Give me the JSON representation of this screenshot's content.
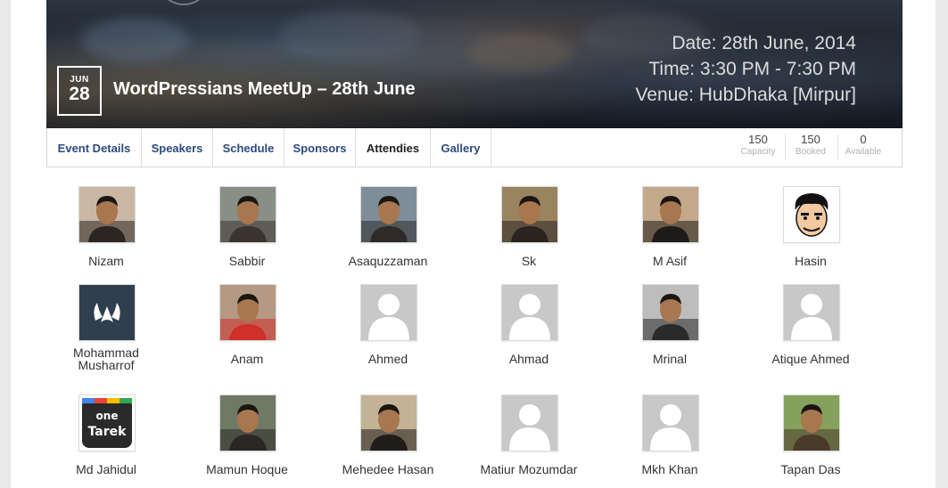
{
  "event": {
    "month": "JUN",
    "day": "28",
    "title": "WordPressians MeetUp – 28th June",
    "date_line": "Date: 28th June, 2014",
    "time_line": "Time: 3:30 PM - 7:30 PM",
    "venue_line": "Venue: HubDhaka [Mirpur]"
  },
  "tabs": [
    {
      "label": "Event Details"
    },
    {
      "label": "Speakers"
    },
    {
      "label": "Schedule"
    },
    {
      "label": "Sponsors"
    },
    {
      "label": "Attendies",
      "active": true
    },
    {
      "label": "Gallery"
    }
  ],
  "stats": [
    {
      "value": "150",
      "label": "Capacity"
    },
    {
      "value": "150",
      "label": "Booked"
    },
    {
      "value": "0",
      "label": "Available"
    }
  ],
  "attendees": [
    {
      "name": "Nizam",
      "avatar": "photo-icon"
    },
    {
      "name": "Sabbir",
      "avatar": "photo-icon"
    },
    {
      "name": "Asaquzzaman",
      "avatar": "photo-icon"
    },
    {
      "name": "Sk",
      "avatar": "photo-icon"
    },
    {
      "name": "M Asif",
      "avatar": "photo-icon"
    },
    {
      "name": "Hasin",
      "avatar": "cartoon-face-icon"
    },
    {
      "name": "Mohammad Musharrof",
      "avatar": "logo-icon"
    },
    {
      "name": "Anam",
      "avatar": "photo-icon"
    },
    {
      "name": "Ahmed",
      "avatar": "default-user-icon"
    },
    {
      "name": "Ahmad",
      "avatar": "default-user-icon"
    },
    {
      "name": "Mrinal",
      "avatar": "photo-icon"
    },
    {
      "name": "Atique Ahmed",
      "avatar": "default-user-icon"
    },
    {
      "name": "Md Jahidul",
      "avatar": "one-tarek-logo-icon",
      "logo_text": [
        "one",
        "Tarek"
      ]
    },
    {
      "name": "Mamun Hoque",
      "avatar": "photo-icon"
    },
    {
      "name": "Mehedee Hasan",
      "avatar": "photo-icon"
    },
    {
      "name": "Matiur Mozumdar",
      "avatar": "default-user-icon"
    },
    {
      "name": "Mkh Khan",
      "avatar": "default-user-icon"
    },
    {
      "name": "Tapan Das",
      "avatar": "photo-icon"
    }
  ]
}
